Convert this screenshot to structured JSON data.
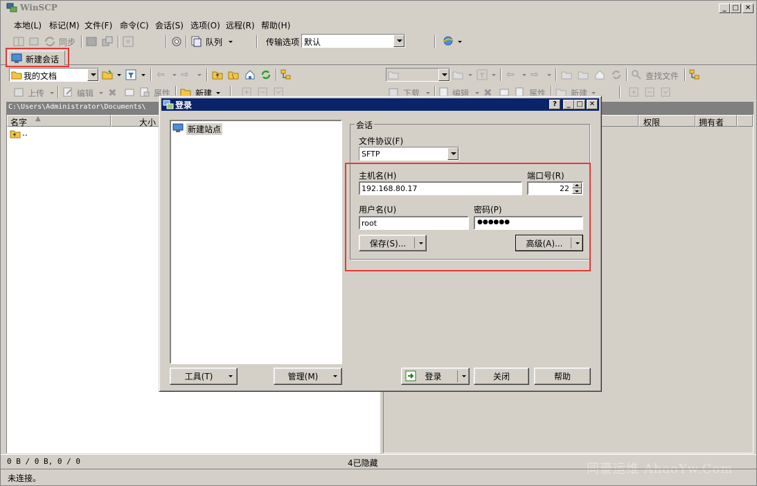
{
  "window": {
    "title": "WinSCP"
  },
  "menu": {
    "local": "本地(L)",
    "mark": "标记(M)",
    "files": "文件(F)",
    "commands": "命令(C)",
    "session": "会话(S)",
    "options": "选项(O)",
    "remote": "远程(R)",
    "help": "帮助(H)"
  },
  "toolbar": {
    "sync": "同步",
    "queue": "队列",
    "transfer_label": "传输选项",
    "transfer_value": "默认"
  },
  "tabs": {
    "new_session": "新建会话"
  },
  "left_panel": {
    "location": "我的文档",
    "upload": "上传",
    "edit": "编辑",
    "properties": "属性",
    "new": "新建",
    "path": "C:\\Users\\Administrator\\Documents\\",
    "columns": {
      "name": "名字",
      "size": "大小"
    },
    "rows": [
      {
        "name": ".."
      }
    ]
  },
  "right_panel": {
    "find_files": "查找文件",
    "download": "下载",
    "edit": "编辑",
    "properties": "属性",
    "new": "新建",
    "columns": {
      "permissions": "权限",
      "owner": "拥有者"
    }
  },
  "status": {
    "bytes": "0 B / 0 B,  0 / 0",
    "hidden": "4已隐藏",
    "connection": "未连接。"
  },
  "watermark": "同豪运维 AhaoYw.Com",
  "login_dialog": {
    "title": "登录",
    "sites": [
      "新建站点"
    ],
    "group_session": "会话",
    "protocol_label": "文件协议(F)",
    "protocol_value": "SFTP",
    "host_label": "主机名(H)",
    "host_value": "192.168.80.17",
    "port_label": "端口号(R)",
    "port_value": "22",
    "user_label": "用户名(U)",
    "user_value": "root",
    "password_label": "密码(P)",
    "password_value": "●●●●●●",
    "save_button": "保存(S)...",
    "advanced_button": "高级(A)...",
    "tools_button": "工具(T)",
    "manage_button": "管理(M)",
    "login_button": "登录",
    "close_button": "关闭",
    "help_button": "帮助"
  }
}
